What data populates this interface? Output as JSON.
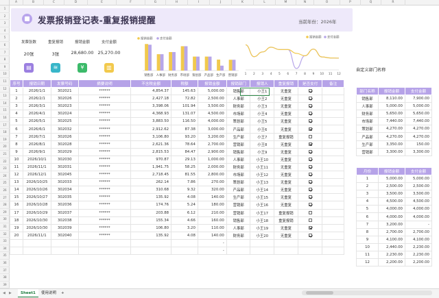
{
  "columns": [
    "A",
    "B",
    "C",
    "D",
    "E",
    "F",
    "G",
    "H",
    "I",
    "J",
    "K",
    "L",
    "M",
    "N",
    "O",
    "P",
    "Q",
    "R"
  ],
  "rows": [
    "1",
    "2",
    "3",
    "4",
    "5",
    "6",
    "7",
    "8",
    "9",
    "10",
    "11",
    "12",
    "13",
    "14",
    "15",
    "16",
    "17",
    "18",
    "19",
    "20",
    "21",
    "22",
    "23",
    "24",
    "25",
    "26",
    "27",
    "28",
    "29",
    "30",
    "31",
    "32",
    "33",
    "34",
    "35",
    "36",
    "37",
    "38",
    "39"
  ],
  "header": {
    "title": "发票报销登记表-重复报销提醒",
    "year_label": "当前年份：",
    "year": "2026年"
  },
  "kpis": [
    {
      "label": "发票张数",
      "value": "20张",
      "icon": "document-icon",
      "color": "#9b7fe0",
      "glyph": "▤"
    },
    {
      "label": "重复报销",
      "value": "3张",
      "icon": "database-icon",
      "color": "#38b6c9",
      "glyph": "≋"
    },
    {
      "label": "报销金额",
      "value": "28,680.00",
      "icon": "yen-icon",
      "color": "#3cba6a",
      "glyph": "¥"
    },
    {
      "label": "支付金额",
      "value": "25,270.00",
      "icon": "note-icon",
      "color": "#f2c94c",
      "glyph": "▥"
    }
  ],
  "chart_data": [
    {
      "type": "bar",
      "legend": [
        "报销金额",
        "支付金额"
      ],
      "legend_position": "top-left",
      "categories": [
        "销售部",
        "人事部",
        "财务部",
        "市场部",
        "策划部",
        "产品部",
        "生产部",
        "营销部"
      ],
      "series": [
        {
          "name": "报销金额",
          "color": "#f1c94d",
          "values": [
            8110,
            5000,
            5650,
            7440,
            4270,
            4270,
            3350,
            3300
          ]
        },
        {
          "name": "支付金额",
          "color": "#b7a6e9",
          "values": [
            7900,
            5000,
            5650,
            7440,
            4270,
            4270,
            1500,
            3300
          ]
        }
      ],
      "ylim": [
        0,
        9000
      ]
    },
    {
      "type": "line",
      "legend": [
        "报销金额",
        "支付金额"
      ],
      "legend_position": "top-right",
      "x": [
        "1",
        "2",
        "3",
        "4",
        "5",
        "6",
        "7",
        "8",
        "9",
        "10",
        "11",
        "12"
      ],
      "series": [
        {
          "name": "报销金额",
          "color": "#f1c94d",
          "values": [
            5000,
            2500,
            3500,
            4500,
            4000,
            4000,
            3200,
            2700,
            4100,
            2440,
            2230,
            2200
          ]
        },
        {
          "name": "支付金额",
          "color": "#b7a6e9",
          "values": [
            5000,
            2500,
            3500,
            4500,
            4000,
            4000,
            0,
            2700,
            4100,
            2440,
            2230,
            2200
          ]
        }
      ],
      "ylim": [
        0,
        5500
      ]
    }
  ],
  "main_table": {
    "headers": [
      "序号",
      "报销日期",
      "发票号码",
      "摘要说明",
      "不含税金额",
      "税额",
      "报销金额",
      "报销部门",
      "报销人",
      "重复报销",
      "是否支付",
      "备注"
    ],
    "rows": [
      [
        "1",
        "2026/1/1",
        "302021",
        "******",
        "4,854.37",
        "145.63",
        "5,000.00",
        "销售部",
        "小王1",
        "无重复",
        "on",
        ""
      ],
      [
        "2",
        "2026/2/1",
        "302026",
        "******",
        "2,427.18",
        "72.82",
        "2,500.00",
        "人事部",
        "小王2",
        "无重复",
        "on",
        ""
      ],
      [
        "3",
        "2026/3/1",
        "302023",
        "******",
        "3,398.06",
        "101.94",
        "3,500.00",
        "财务部",
        "小王3",
        "无重复",
        "on",
        ""
      ],
      [
        "4",
        "2026/4/1",
        "302024",
        "******",
        "4,368.93",
        "131.07",
        "4,500.00",
        "市场部",
        "小王4",
        "无重复",
        "on",
        ""
      ],
      [
        "5",
        "2026/5/1",
        "302025",
        "******",
        "3,883.50",
        "116.50",
        "4,000.00",
        "策划部",
        "小王5",
        "无重复",
        "on",
        ""
      ],
      [
        "6",
        "2026/6/1",
        "302032",
        "******",
        "2,912.62",
        "87.38",
        "3,000.00",
        "产品部",
        "小王6",
        "无重复",
        "on",
        ""
      ],
      [
        "7",
        "2026/7/1",
        "302026",
        "******",
        "3,106.80",
        "93.20",
        "3,200.00",
        "生产部",
        "小王7",
        "重复报销",
        "off",
        ""
      ],
      [
        "8",
        "2026/8/1",
        "302028",
        "******",
        "2,621.36",
        "78.64",
        "2,700.00",
        "营销部",
        "小王8",
        "无重复",
        "on",
        ""
      ],
      [
        "9",
        "2026/9/1",
        "302029",
        "******",
        "2,815.53",
        "84.47",
        "2,900.00",
        "销售部",
        "小王9",
        "无重复",
        "on",
        ""
      ],
      [
        "10",
        "2026/10/1",
        "302030",
        "******",
        "970.87",
        "29.13",
        "1,000.00",
        "人事部",
        "小王10",
        "无重复",
        "on",
        ""
      ],
      [
        "11",
        "2026/11/1",
        "302031",
        "******",
        "1,941.75",
        "58.25",
        "2,000.00",
        "财务部",
        "小王11",
        "无重复",
        "on",
        ""
      ],
      [
        "12",
        "2026/12/1",
        "302045",
        "******",
        "2,718.45",
        "81.55",
        "2,800.00",
        "市场部",
        "小王12",
        "无重复",
        "on",
        ""
      ],
      [
        "13",
        "2026/10/25",
        "302033",
        "******",
        "262.14",
        "7.86",
        "270.00",
        "策划部",
        "小王13",
        "无重复",
        "on",
        ""
      ],
      [
        "14",
        "2026/10/26",
        "302034",
        "******",
        "310.68",
        "9.32",
        "320.00",
        "产品部",
        "小王14",
        "无重复",
        "on",
        ""
      ],
      [
        "15",
        "2026/10/27",
        "302035",
        "******",
        "135.92",
        "4.08",
        "140.00",
        "生产部",
        "小王15",
        "无重复",
        "on",
        ""
      ],
      [
        "16",
        "2026/10/28",
        "302036",
        "******",
        "174.76",
        "5.24",
        "180.00",
        "营销部",
        "小王16",
        "无重复",
        "on",
        ""
      ],
      [
        "17",
        "2026/10/29",
        "302037",
        "******",
        "203.88",
        "6.12",
        "210.00",
        "营销部",
        "小王17",
        "重复报销",
        "off",
        ""
      ],
      [
        "18",
        "2026/10/30",
        "302038",
        "******",
        "155.34",
        "4.66",
        "160.00",
        "销售部",
        "小王18",
        "重复报销",
        "off",
        ""
      ],
      [
        "19",
        "2026/10/30",
        "302039",
        "******",
        "106.80",
        "3.20",
        "110.00",
        "人事部",
        "小王19",
        "无重复",
        "on",
        ""
      ],
      [
        "20",
        "2026/11/1",
        "302040",
        "******",
        "135.92",
        "4.08",
        "140.00",
        "财务部",
        "小王20",
        "无重复",
        "on",
        ""
      ],
      [
        "",
        "",
        "",
        "",
        "",
        "",
        "-",
        "",
        "",
        "",
        "",
        ""
      ],
      [
        "",
        "",
        "",
        "",
        "",
        "",
        "-",
        "",
        "",
        "",
        "",
        ""
      ]
    ]
  },
  "dept_section_label": "自定义部门名称",
  "dept_table": {
    "headers": [
      "部门名称",
      "报销金额",
      "支付金额"
    ],
    "rows": [
      [
        "销售部",
        "8,110.00",
        "7,900.00"
      ],
      [
        "人事部",
        "5,000.00",
        "5,000.00"
      ],
      [
        "财务部",
        "5,650.00",
        "5,650.00"
      ],
      [
        "市场部",
        "7,440.00",
        "7,440.00"
      ],
      [
        "策划部",
        "4,270.00",
        "4,270.00"
      ],
      [
        "产品部",
        "4,270.00",
        "4,270.00"
      ],
      [
        "生产部",
        "3,350.00",
        "150.00"
      ],
      [
        "营销部",
        "3,300.00",
        "3,300.00"
      ]
    ]
  },
  "month_table": {
    "headers": [
      "月份",
      "报销金额",
      "支付金额"
    ],
    "rows": [
      [
        "1",
        "5,000.00",
        "5,000.00"
      ],
      [
        "2",
        "2,500.00",
        "2,500.00"
      ],
      [
        "3",
        "3,500.00",
        "3,500.00"
      ],
      [
        "4",
        "4,500.00",
        "4,500.00"
      ],
      [
        "5",
        "4,000.00",
        "4,000.00"
      ],
      [
        "6",
        "4,000.00",
        "4,000.00"
      ],
      [
        "7",
        "3,200.00",
        "-"
      ],
      [
        "8",
        "2,700.00",
        "2,700.00"
      ],
      [
        "9",
        "4,100.00",
        "4,100.00"
      ],
      [
        "10",
        "2,440.00",
        "2,230.00"
      ],
      [
        "11",
        "2,230.00",
        "2,230.00"
      ],
      [
        "12",
        "2,200.00",
        "2,200.00"
      ]
    ]
  },
  "sheet_tabs": [
    "Sheet1",
    "使用说明"
  ],
  "add_tab": "+",
  "nav_arrows": [
    "◀",
    "▶"
  ]
}
